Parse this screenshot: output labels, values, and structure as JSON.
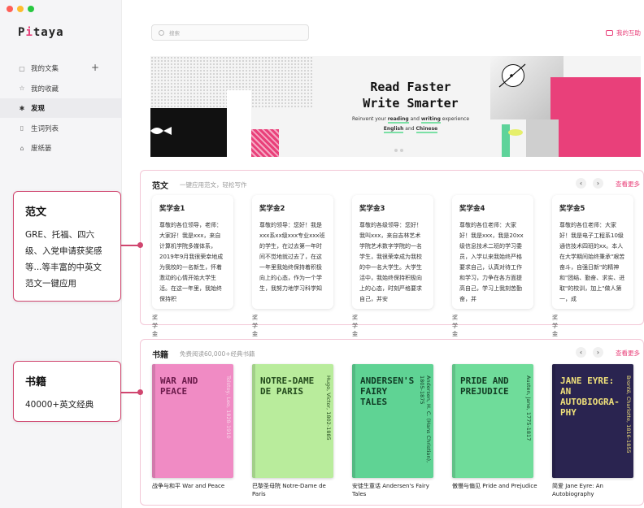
{
  "app": {
    "logo_prefix": "P",
    "logo_dot": "i",
    "logo_rest": "taya"
  },
  "sidebar": {
    "items": [
      {
        "label": "我的文集",
        "icon": "document-icon"
      },
      {
        "label": "我的收藏",
        "icon": "star-icon"
      },
      {
        "label": "发现",
        "icon": "discover-icon"
      },
      {
        "label": "生词列表",
        "icon": "notebook-icon"
      },
      {
        "label": "废纸篓",
        "icon": "trash-icon"
      }
    ],
    "plus": "+"
  },
  "header": {
    "search_placeholder": "搜索",
    "my_interact": "我的互助"
  },
  "banner": {
    "title_line1": "Read Faster",
    "title_line2": "Write Smarter",
    "sub_pre": "Reinvent your ",
    "sub_reading": "reading",
    "sub_and": " and ",
    "sub_writing": "writing",
    "sub_post": " experience",
    "lang_en": "English",
    "lang_and": " and ",
    "lang_zh": "Chinese"
  },
  "essays": {
    "title": "范文",
    "subtitle": "一键应用范文，轻松写作",
    "see_more": "查看更多",
    "cards": [
      {
        "title": "奖学金1",
        "body": "尊敬的各位领导，老师：大家好！我是xxx，来自计算机学院多媒体系，2019年9月我很荣幸地成为我校的一名新生，怀着激动的心情开始大学生活。在这一年里，我始终保持积",
        "tag": "奖学金"
      },
      {
        "title": "奖学金2",
        "body": "尊敬的领导：您好！我是xxx系xx级xxx专业xxx班的学生，在过去第一年时间不觉地就过去了，在这一年里我始终保持着积极向上的心态，作为一个学生，我努力地学习科学知",
        "tag": "奖学金"
      },
      {
        "title": "奖学金3",
        "body": "尊敬的各级领导：您好！我叫xxx，来自吉林艺术学院艺术数字学院的一名学生，我很荣幸成为我校的中一名大学生。大学生活中，我始终保持积极向上的心态，时刻严格要求自己，并安",
        "tag": "奖学金"
      },
      {
        "title": "奖学金4",
        "body": "尊敬的各位老师：大家好！我是xxx，我是20xx级信息技术二班的学习委员，入学以来我始终严格要求自己，认真对待工作和学习，力争在各方面提高自己，学习上我刻苦勤奋，并",
        "tag": "奖学金"
      },
      {
        "title": "奖学金5",
        "body": "尊敬的各位老师：大家好！我是电子工程系10级通信技术四班的xx。本人在大学期间始终秉承\"艰苦奋斗，自强日新\"的精神和\"团结、勤奋、求实、进取\"的校训，加上\"做人第一，成",
        "tag": "奖学金"
      }
    ]
  },
  "books": {
    "title": "书籍",
    "subtitle": "免费阅读60,000+经典书籍",
    "see_more": "查看更多",
    "items": [
      {
        "cover_title": "WAR AND PEACE",
        "author": "Tolstoy, Leo, 1828-1910",
        "caption": "战争与和平 War and Peace",
        "bg": "#f08bc4",
        "fg": "#6a1a4a"
      },
      {
        "cover_title": "NOTRE-DAME DE PARIS",
        "author": "Hugo, Victor, 1802-1885",
        "caption": "巴黎圣母院 Notre-Dame de Paris",
        "bg": "#b9ec9c",
        "fg": "#234a1c"
      },
      {
        "cover_title": "ANDERSEN'S FAIRY TALES",
        "author": "Andersen, H. C. (Hans Christian), 1805-1875",
        "caption": "安徒生童话 Andersen's Fairy Tales",
        "bg": "#5fd394",
        "fg": "#0f3a24"
      },
      {
        "cover_title": "PRIDE AND PREJUDICE",
        "author": "Austen, Jane, 1775-1817",
        "caption": "傲慢与偏见 Pride and Prejudice",
        "bg": "#6fdc9a",
        "fg": "#113a22"
      },
      {
        "cover_title": "JANE EYRE: AN AUTOBIOGRA-PHY",
        "author": "Brontë, Charlotte, 1816-1855",
        "caption": "简爱 Jane Eyre: An Autobiography",
        "bg": "#2a2450",
        "fg": "#efe07a"
      }
    ]
  },
  "callouts": {
    "essay_title": "范文",
    "essay_text": "GRE、托福、四六级、入党申请获奖感等...等丰富的中英文范文一键应用",
    "book_title": "书籍",
    "book_text": "40000+英文经典"
  },
  "colors": {
    "accent": "#e9407a",
    "callout_border": "#d0466f"
  }
}
